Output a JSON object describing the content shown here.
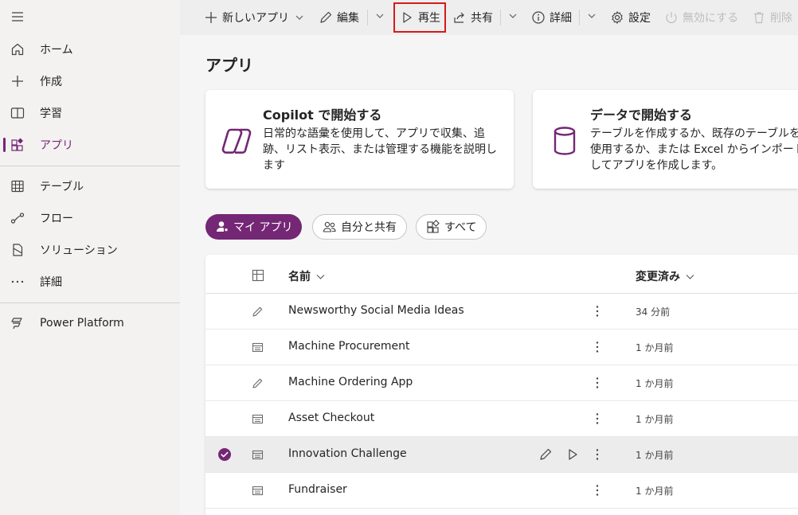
{
  "sidebar": {
    "items": [
      {
        "label": "ホーム",
        "icon": "home-icon"
      },
      {
        "label": "作成",
        "icon": "plus-icon"
      },
      {
        "label": "学習",
        "icon": "book-icon"
      },
      {
        "label": "アプリ",
        "icon": "apps-icon",
        "selected": true
      },
      {
        "label": "テーブル",
        "icon": "table-icon"
      },
      {
        "label": "フロー",
        "icon": "flow-icon"
      },
      {
        "label": "ソリューション",
        "icon": "solution-icon"
      },
      {
        "label": "詳細",
        "icon": "more-icon"
      },
      {
        "label": "Power Platform",
        "icon": "power-platform-icon"
      }
    ]
  },
  "toolbar": {
    "new_app": "新しいアプリ",
    "edit": "編集",
    "play": "再生",
    "share": "共有",
    "details": "詳細",
    "settings": "設定",
    "deactivate": "無効にする",
    "delete": "削除"
  },
  "page": {
    "title": "アプリ"
  },
  "cards": [
    {
      "title": "Copilot で開始する",
      "description": "日常的な語彙を使用して、アプリで収集、追跡、リスト表示、または管理する機能を説明します"
    },
    {
      "title": "データで開始する",
      "description": "テーブルを作成するか、既存のテーブルを使用するか、または Excel からインポートしてアプリを作成します。"
    }
  ],
  "filters": [
    {
      "label": "マイ アプリ",
      "active": true
    },
    {
      "label": "自分と共有",
      "active": false
    },
    {
      "label": "すべて",
      "active": false
    }
  ],
  "table": {
    "columns": {
      "name": "名前",
      "modified": "変更済み"
    },
    "rows": [
      {
        "name": "Newsworthy Social Media Ideas",
        "modified": "34 分前",
        "type": "canvas"
      },
      {
        "name": "Machine Procurement",
        "modified": "1 か月前",
        "type": "model"
      },
      {
        "name": "Machine Ordering App",
        "modified": "1 か月前",
        "type": "canvas"
      },
      {
        "name": "Asset Checkout",
        "modified": "1 か月前",
        "type": "model"
      },
      {
        "name": "Innovation Challenge",
        "modified": "1 か月前",
        "type": "model",
        "selected": true
      },
      {
        "name": "Fundraiser",
        "modified": "1 か月前",
        "type": "model"
      }
    ]
  },
  "colors": {
    "accent": "#742774",
    "highlight": "#d51a1a"
  }
}
